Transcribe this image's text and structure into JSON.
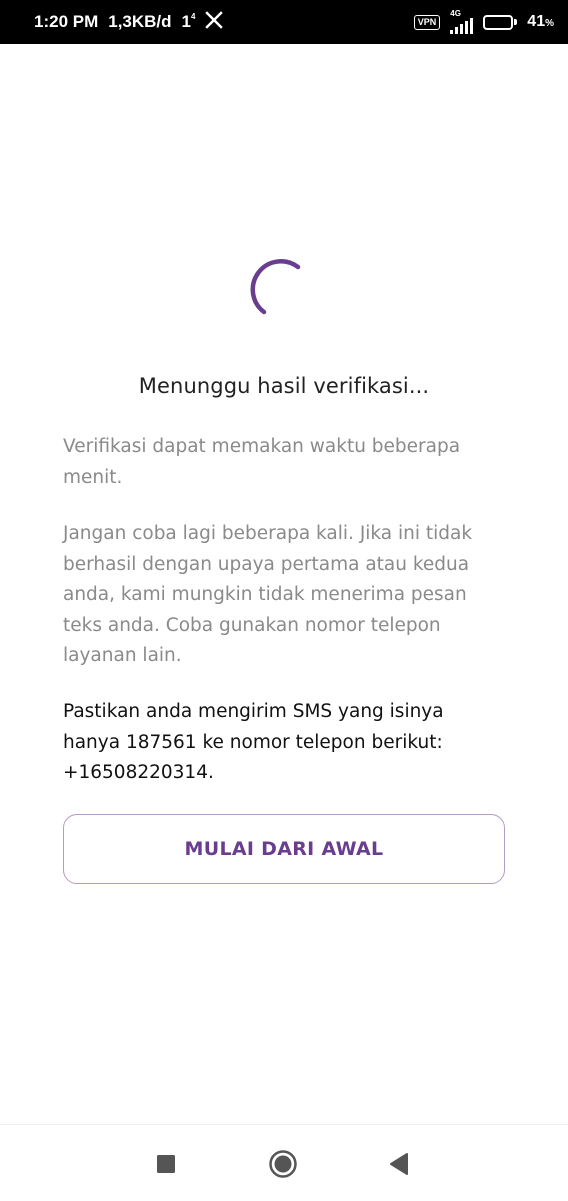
{
  "status_bar": {
    "time": "1:20 PM",
    "speed": "1,3KB/d",
    "sim_indicator": "1",
    "app_icon": "x-icon",
    "vpn": "VPN",
    "network": "4G",
    "battery_level": 0.41,
    "battery_percent": "41",
    "battery_percent_unit": "%"
  },
  "accent_color": "#6a3e8e",
  "title": "Menunggu hasil verifikasi...",
  "paragraph1": "Verifikasi dapat memakan waktu beberapa menit.",
  "paragraph2": "Jangan coba lagi beberapa kali. Jika ini tidak berhasil dengan upaya pertama atau kedua anda, kami mungkin tidak menerima pesan teks anda. Coba gunakan nomor telepon layanan lain.",
  "paragraph3": "Pastikan anda mengirim SMS yang isinya hanya 187561 ke nomor telepon berikut: +16508220314.",
  "restart_button_label": "MULAI DARI AWAL",
  "nav_bar": {
    "recent_icon": "square-icon",
    "home_icon": "circle-icon",
    "back_icon": "triangle-back-icon"
  }
}
